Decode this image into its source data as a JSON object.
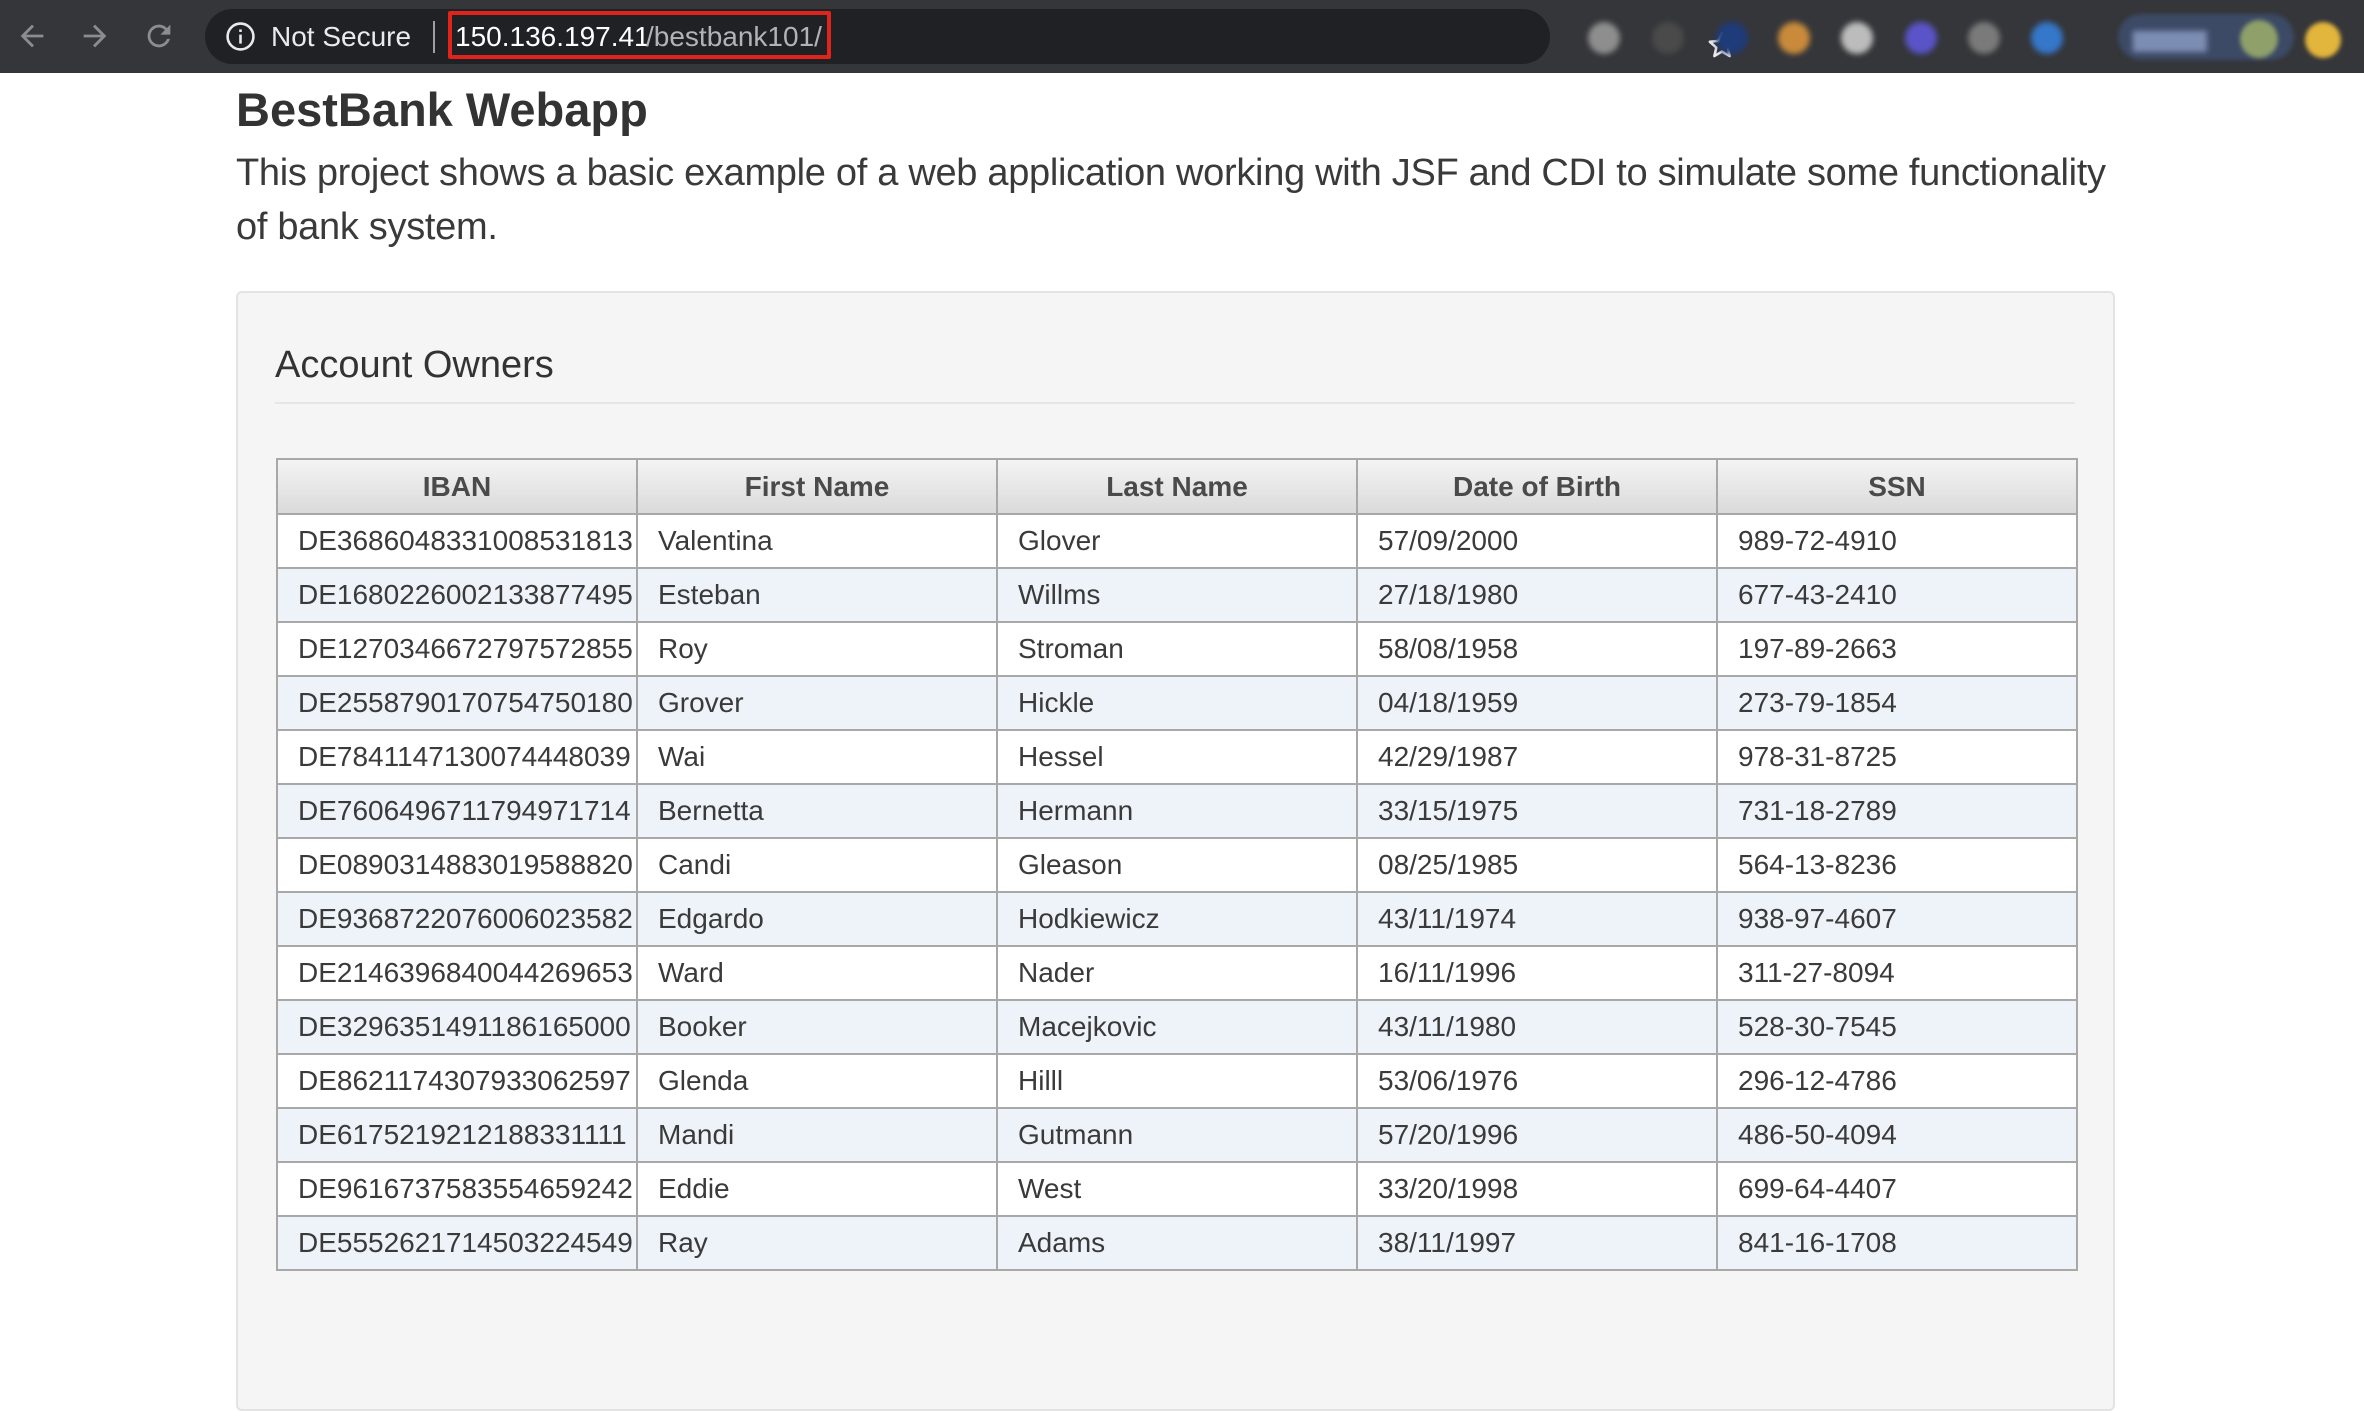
{
  "browser": {
    "security_label": "Not Secure",
    "url_host": "150.136.197.41",
    "url_path": "/bestbank101/",
    "highlight_color": "#e0231b"
  },
  "page": {
    "title": "BestBank Webapp",
    "description": "This project shows a basic example of a web application working with JSF and CDI to simulate some functionality of bank system."
  },
  "panel": {
    "title": "Account Owners"
  },
  "table": {
    "headers": [
      "IBAN",
      "First Name",
      "Last Name",
      "Date of Birth",
      "SSN"
    ],
    "rows": [
      [
        "DE3686048331008531813",
        "Valentina",
        "Glover",
        "57/09/2000",
        "989-72-4910"
      ],
      [
        "DE1680226002133877495",
        "Esteban",
        "Willms",
        "27/18/1980",
        "677-43-2410"
      ],
      [
        "DE1270346672797572855",
        "Roy",
        "Stroman",
        "58/08/1958",
        "197-89-2663"
      ],
      [
        "DE2558790170754750180",
        "Grover",
        "Hickle",
        "04/18/1959",
        "273-79-1854"
      ],
      [
        "DE7841147130074448039",
        "Wai",
        "Hessel",
        "42/29/1987",
        "978-31-8725"
      ],
      [
        "DE7606496711794971714",
        "Bernetta",
        "Hermann",
        "33/15/1975",
        "731-18-2789"
      ],
      [
        "DE0890314883019588820",
        "Candi",
        "Gleason",
        "08/25/1985",
        "564-13-8236"
      ],
      [
        "DE9368722076006023582",
        "Edgardo",
        "Hodkiewicz",
        "43/11/1974",
        "938-97-4607"
      ],
      [
        "DE2146396840044269653",
        "Ward",
        "Nader",
        "16/11/1996",
        "311-27-8094"
      ],
      [
        "DE3296351491186165000",
        "Booker",
        "Macejkovic",
        "43/11/1980",
        "528-30-7545"
      ],
      [
        "DE8621174307933062597",
        "Glenda",
        "Hilll",
        "53/06/1976",
        "296-12-4786"
      ],
      [
        "DE6175219212188331111",
        "Mandi",
        "Gutmann",
        "57/20/1996",
        "486-50-4094"
      ],
      [
        "DE9616737583554659242",
        "Eddie",
        "West",
        "33/20/1998",
        "699-64-4407"
      ],
      [
        "DE5552621714503224549",
        "Ray",
        "Adams",
        "38/11/1997",
        "841-16-1708"
      ]
    ]
  }
}
